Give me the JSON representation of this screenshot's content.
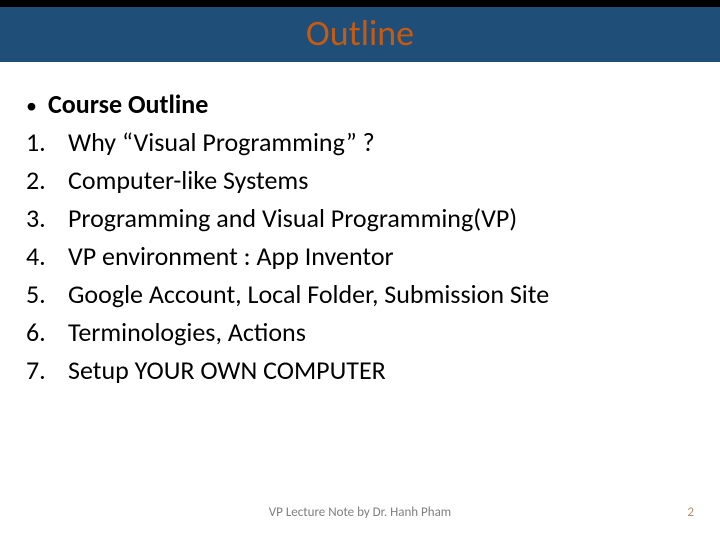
{
  "header": {
    "title": "Outline"
  },
  "content": {
    "bullet_label": "Course Outline",
    "items": [
      {
        "num": "1.",
        "text": "Why “Visual Programming” ?"
      },
      {
        "num": "2.",
        "text": "Computer-like Systems"
      },
      {
        "num": "3.",
        "text": "Programming and Visual Programming(VP)"
      },
      {
        "num": "4.",
        "text": "VP environment : App Inventor"
      },
      {
        "num": "5.",
        "text": "Google Account, Local Folder, Submission Site"
      },
      {
        "num": "6.",
        "text": "Terminologies, Actions"
      },
      {
        "num": "7.",
        "text": "Setup YOUR OWN COMPUTER"
      }
    ]
  },
  "footer": {
    "note": "VP Lecture Note by Dr. Hanh Pham",
    "page": "2"
  }
}
